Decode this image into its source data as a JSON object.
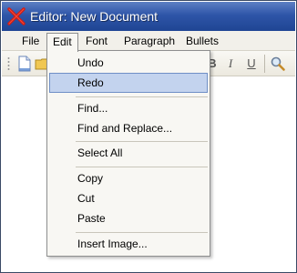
{
  "window": {
    "title": "Editor: New Document",
    "icon": "red-x-icon"
  },
  "menubar": {
    "items": [
      "File",
      "Edit",
      "Font",
      "Paragraph",
      "Bullets"
    ],
    "open": "Edit"
  },
  "toolbar": {
    "bold_label": "B",
    "italic_label": "I",
    "underline_label": "U",
    "icons": [
      "new-document-icon",
      "open-folder-icon",
      "search-icon"
    ]
  },
  "edit_menu": {
    "items": [
      {
        "label": "Undo"
      },
      {
        "label": "Redo",
        "selected": true
      },
      {
        "label": "Find..."
      },
      {
        "label": "Find and Replace..."
      },
      {
        "label": "Select All"
      },
      {
        "label": "Copy"
      },
      {
        "label": "Cut"
      },
      {
        "label": "Paste"
      },
      {
        "label": "Insert Image..."
      }
    ]
  },
  "colors": {
    "titlebar": "#2e55a8",
    "highlight": "#c3d3ee"
  }
}
